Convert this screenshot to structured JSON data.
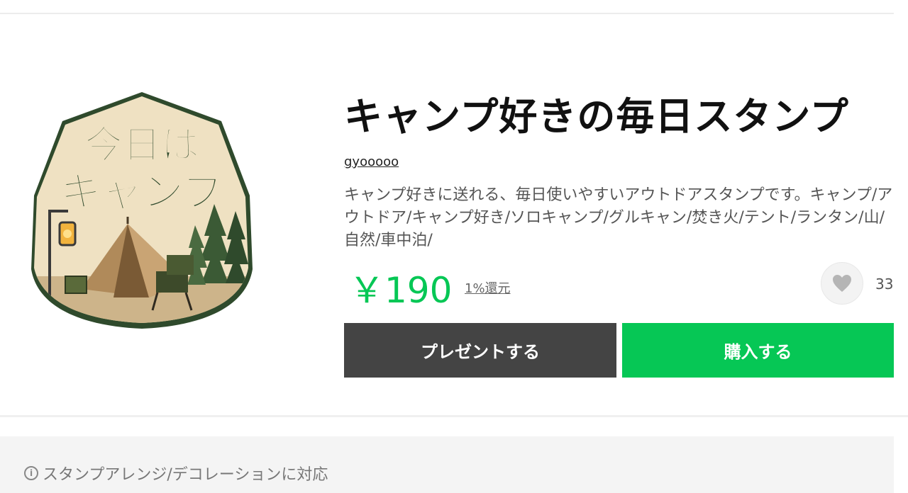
{
  "product": {
    "title": "キャンプ好きの毎日スタンプ",
    "author": "gyooooo",
    "description": "キャンプ好きに送れる、毎日使いやすいアウトドアスタンプです。キャンプ/アウトドア/キャンプ好き/ソロキャンプ/グルキャン/焚き火/テント/ランタン/山/自然/車中泊/",
    "price": "￥190",
    "cashback": "1%還元",
    "like_count": "33"
  },
  "sticker": {
    "line1": "今日は",
    "line2": "キャンプ"
  },
  "buttons": {
    "present": "プレゼントする",
    "buy": "購入する"
  },
  "info": {
    "text": "スタンプアレンジ/デコレーションに対応"
  },
  "colors": {
    "accent_green": "#06c755",
    "present_button": "#444444"
  },
  "icons": [
    "heart-icon",
    "info-icon"
  ]
}
